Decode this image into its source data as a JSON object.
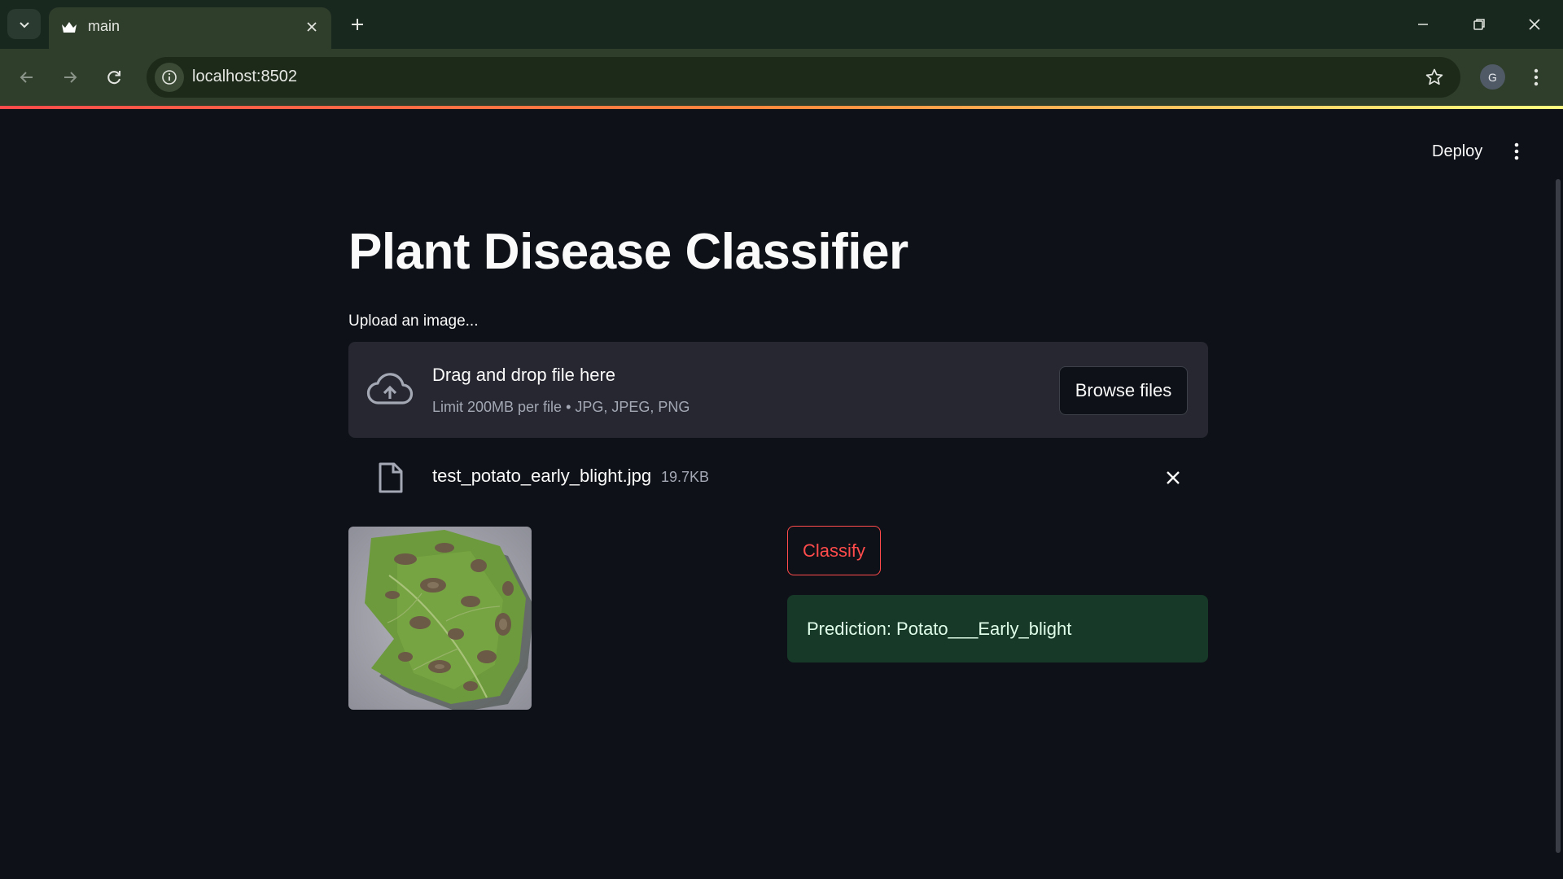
{
  "browser": {
    "tab_title": "main",
    "url": "localhost:8502",
    "profile_initial": "G"
  },
  "app": {
    "deploy_label": "Deploy",
    "title": "Plant Disease Classifier",
    "upload_label": "Upload an image...",
    "dropzone": {
      "title": "Drag and drop file here",
      "limit_text": "Limit 200MB per file • JPG, JPEG, PNG",
      "browse_label": "Browse files"
    },
    "uploaded_file": {
      "name": "test_potato_early_blight.jpg",
      "size": "19.7KB"
    },
    "classify_label": "Classify",
    "prediction_text": "Prediction: Potato___Early_blight"
  },
  "colors": {
    "background": "#0e1117",
    "accent": "#ff4b4b",
    "success_bg": "#173928",
    "browser_frame": "#2f3d2b"
  },
  "icons": [
    "chevron-down-icon",
    "streamlit-crown-icon",
    "close-icon",
    "plus-icon",
    "minimize-icon",
    "restore-icon",
    "back-arrow-icon",
    "forward-arrow-icon",
    "reload-icon",
    "info-icon",
    "star-icon",
    "kebab-menu-icon",
    "cloud-upload-icon",
    "file-icon"
  ]
}
